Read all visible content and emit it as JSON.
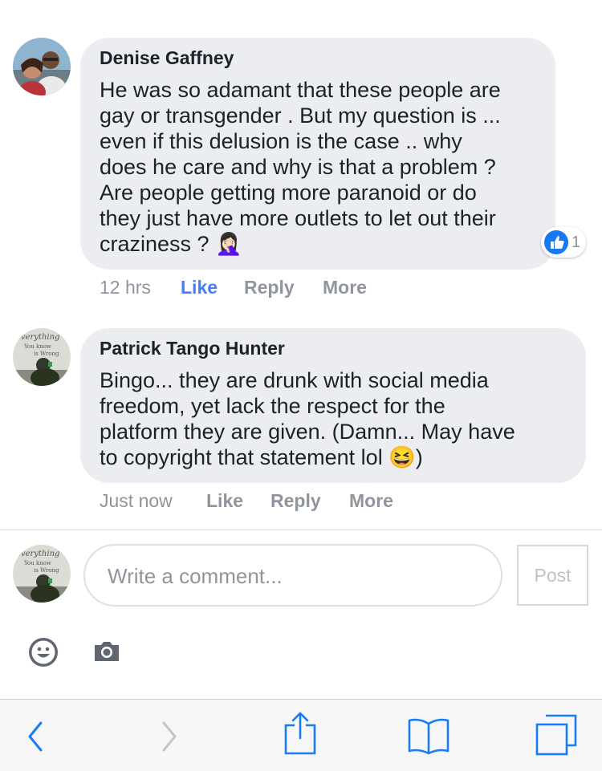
{
  "comments": [
    {
      "author": "Denise Gaffney",
      "lines": [
        "He was so adamant that these people are",
        "gay or transgender . But my question is ...",
        "even if this delusion is the case .. why",
        "does he care and why is that a problem ?",
        "Are people getting more paranoid or do",
        "they just have more outlets to let out their",
        "craziness ? 🤦🏻‍♀️"
      ],
      "time": "12 hrs",
      "like_label": "Like",
      "reply_label": "Reply",
      "more_label": "More",
      "reaction_count": "1",
      "liked": true
    },
    {
      "author": "Patrick Tango Hunter",
      "lines": [
        "Bingo... they are drunk with social media",
        "freedom, yet lack the respect for the",
        "platform they are given. (Damn... May have",
        "to copyright that statement lol 😆)"
      ],
      "time": "Just now",
      "like_label": "Like",
      "reply_label": "Reply",
      "more_label": "More",
      "avatar_text": [
        "everything",
        "You know",
        "is Wrong"
      ]
    }
  ],
  "composer": {
    "placeholder": "Write a comment...",
    "post_label": "Post",
    "avatar_text": [
      "everything",
      "You know",
      "is Wrong"
    ]
  },
  "icons": {
    "emoji": "smiley-icon",
    "camera": "camera-icon",
    "back": "chevron-left-icon",
    "forward": "chevron-right-icon",
    "share": "share-icon",
    "bookmarks": "book-icon",
    "tabs": "tabs-icon",
    "reaction": "thumbs-up-icon"
  },
  "colors": {
    "bubble": "#ebedf0",
    "link_blue": "#4080ff",
    "muted": "#90949c",
    "safari_blue": "#1a7cf5"
  }
}
